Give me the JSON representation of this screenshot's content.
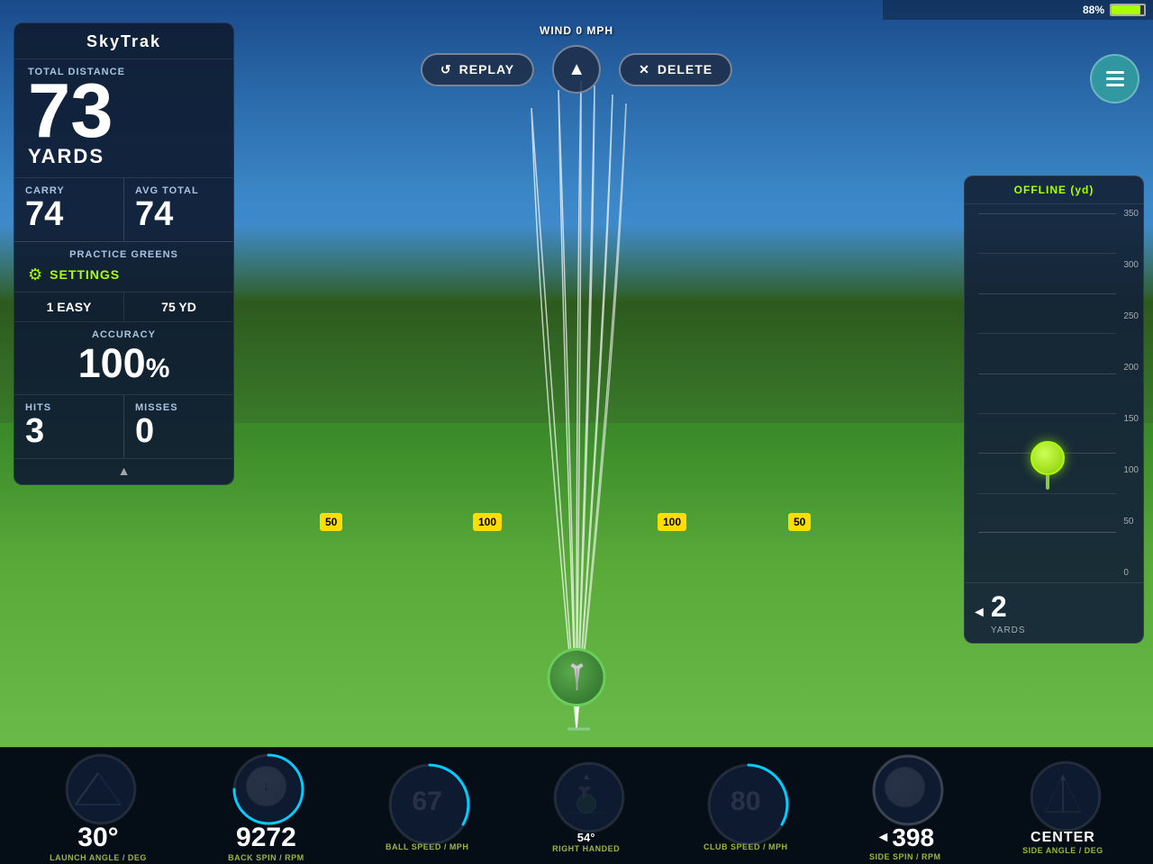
{
  "app": {
    "name": "SkyTrak",
    "battery": "88%"
  },
  "wind": {
    "label": "WIND 0 MPH"
  },
  "controls": {
    "replay": "REPLAY",
    "delete": "DELETE"
  },
  "left_panel": {
    "logo": "SKYTRAK",
    "total_distance_label": "TOTAL DISTANCE",
    "total_distance_value": "73",
    "yards_label": "YARDS",
    "carry_label": "CARRY",
    "carry_value": "74",
    "avg_total_label": "AVG TOTAL",
    "avg_total_value": "74",
    "practice_label": "PRACTICE GREENS",
    "settings_label": "SETTINGS",
    "mode_value": "1 EASY",
    "distance_value": "75 YD",
    "accuracy_label": "ACCURACY",
    "accuracy_value": "100",
    "accuracy_percent": "%",
    "hits_label": "HITS",
    "hits_value": "3",
    "misses_label": "MISSES",
    "misses_value": "0"
  },
  "right_panel": {
    "title": "OFFLINE (yd)",
    "yards_label": "YARDS",
    "yards_value": "2",
    "yardage_marks": [
      "350",
      "300",
      "250",
      "200",
      "150",
      "100",
      "50",
      "0"
    ]
  },
  "bottom_metrics": [
    {
      "id": "launch_angle",
      "value": "30°",
      "label": "LAUNCH ANGLE / DEG"
    },
    {
      "id": "back_spin",
      "value": "9272",
      "label": "BACK SPIN / RPM"
    },
    {
      "id": "ball_speed",
      "value": "67",
      "label": "BALL SPEED / MPH"
    },
    {
      "id": "right_handed",
      "value": "54°",
      "label": "RIGHT HANDED"
    },
    {
      "id": "club_speed",
      "value": "80",
      "label": "CLUB SPEED / MPH"
    },
    {
      "id": "side_spin",
      "value": "398",
      "label": "SIDE SPIN / RPM"
    },
    {
      "id": "side_angle",
      "value": "CENTER",
      "label": "SIDE ANGLE / DEG"
    }
  ],
  "yardage_markers": [
    "50",
    "100",
    "100",
    "50"
  ]
}
